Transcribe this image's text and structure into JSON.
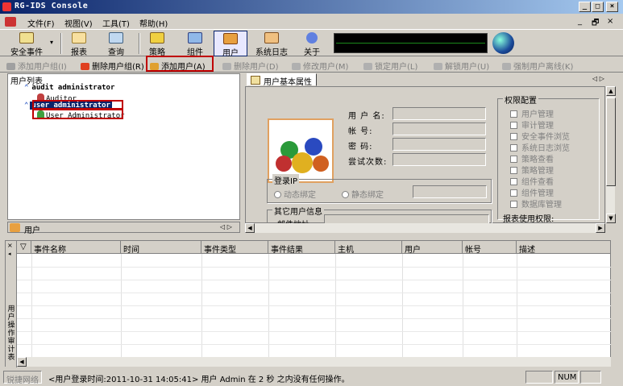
{
  "window": {
    "title": "RG-IDS Console",
    "min": "_",
    "max": "□",
    "close": "×"
  },
  "menu": [
    {
      "label": "文件(F)"
    },
    {
      "label": "视图(V)"
    },
    {
      "label": "工具(T)"
    },
    {
      "label": "帮助(H)"
    }
  ],
  "menu_right": {
    "min": "_",
    "restore": "🗗",
    "close": "×"
  },
  "toolbar": [
    {
      "label": "安全事件",
      "icon": "security-event-icon"
    },
    {
      "label": "报表",
      "icon": "report-icon"
    },
    {
      "label": "查询",
      "icon": "query-icon"
    },
    {
      "label": "策略",
      "icon": "policy-icon"
    },
    {
      "label": "组件",
      "icon": "component-icon"
    },
    {
      "label": "用户",
      "icon": "user-icon",
      "selected": true
    },
    {
      "label": "系统日志",
      "icon": "system-log-icon"
    },
    {
      "label": "关于",
      "icon": "about-icon"
    }
  ],
  "actions": [
    {
      "label": "添加用户组(I)",
      "enabled": false
    },
    {
      "label": "删除用户组(R)",
      "enabled": true
    },
    {
      "label": "添加用户(A)",
      "enabled": true
    },
    {
      "label": "删除用户(D)",
      "enabled": false
    },
    {
      "label": "修改用户(M)",
      "enabled": false
    },
    {
      "label": "锁定用户(L)",
      "enabled": false
    },
    {
      "label": "解锁用户(U)",
      "enabled": false
    },
    {
      "label": "强制用户离线(K)",
      "enabled": false
    }
  ],
  "tree": {
    "title": "用户列表",
    "groups": [
      {
        "name": "audit administrator",
        "users": [
          "Auditor"
        ]
      },
      {
        "name": "user administrator",
        "users": [
          "User Administrator"
        ]
      }
    ]
  },
  "left_tab": {
    "label": "用户",
    "nav": "◁ ▷"
  },
  "right_tab": {
    "label": "用户基本属性",
    "nav": "◁ ▷"
  },
  "form": {
    "username_label": "用 户 名:",
    "account_label": "帐    号:",
    "password_label": "密    码:",
    "attempts_label": "尝试次数:",
    "login_ip_group": "登录IP",
    "dynamic_bind": "动态绑定",
    "static_bind": "静态绑定",
    "other_info_group": "其它用户信息",
    "email_label": "邮件地址:"
  },
  "permissions": {
    "title": "权限配置",
    "items": [
      "用户管理",
      "审计管理",
      "安全事件浏览",
      "系统日志浏览",
      "策略查看",
      "策略管理",
      "组件查看",
      "组件管理",
      "数据库管理"
    ],
    "report_label": "报表使用权限:"
  },
  "events_table": {
    "columns": [
      "事件名称",
      "时间",
      "事件类型",
      "事件结果",
      "主机",
      "用户",
      "帐号",
      "描述"
    ],
    "side_label": "用户操作审计表"
  },
  "status": {
    "brand": "锐捷网络",
    "message": "<用户登录时间:2011-10-31 14:05:41> 用户 Admin 在 2 秒 之内没有任何操作。",
    "num": "NUM"
  }
}
